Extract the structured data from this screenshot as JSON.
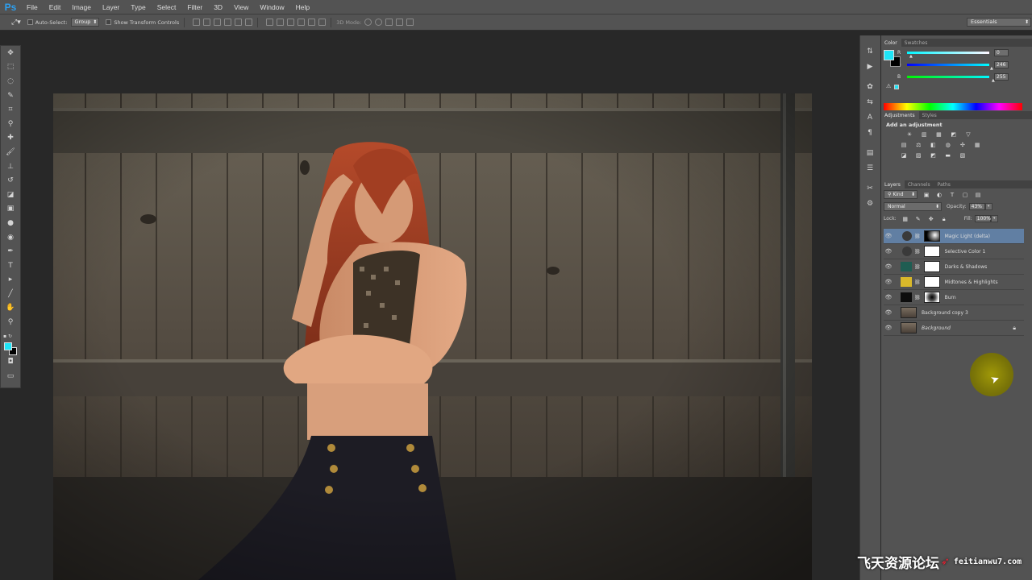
{
  "app": {
    "logo": "Ps"
  },
  "menu": [
    "File",
    "Edit",
    "Image",
    "Layer",
    "Type",
    "Select",
    "Filter",
    "3D",
    "View",
    "Window",
    "Help"
  ],
  "options": {
    "auto_select_label": "Auto-Select:",
    "auto_select_value": "Group",
    "transform_label": "Show Transform Controls",
    "mode3d_label": "3D Mode:",
    "workspace": "Essentials"
  },
  "color_panel": {
    "tabs": [
      "Color",
      "Swatches"
    ],
    "foreground": "#1ee4f6",
    "background": "#000000",
    "channels": [
      {
        "label": "R",
        "value": "0"
      },
      {
        "label": "G",
        "value": "246"
      },
      {
        "label": "B",
        "value": "255"
      }
    ]
  },
  "adjustments_panel": {
    "tabs": [
      "Adjustments",
      "Styles"
    ],
    "heading": "Add an adjustment"
  },
  "layers_panel": {
    "tabs": [
      "Layers",
      "Channels",
      "Paths"
    ],
    "kind_label": "Kind",
    "blend_mode": "Normal",
    "opacity_label": "Opacity:",
    "opacity_value": "43%",
    "lock_label": "Lock:",
    "fill_label": "Fill:",
    "fill_value": "100%",
    "layers": [
      {
        "name": "Magic Light (delta)",
        "selected": true,
        "thumb_color": "#3a3a3a",
        "mask": "gradient"
      },
      {
        "name": "Selective Color 1",
        "selected": false,
        "thumb_color": "#3a3a3a",
        "mask": "white"
      },
      {
        "name": "Darks & Shadows",
        "selected": false,
        "thumb_color": "#1f5d52",
        "mask": "white"
      },
      {
        "name": "Midtones & Highlights",
        "selected": false,
        "thumb_color": "#d9b82a",
        "mask": "white"
      },
      {
        "name": "Burn",
        "selected": false,
        "thumb_color": "#0d0d0d",
        "mask": "radial"
      },
      {
        "name": "Background copy 3",
        "selected": false,
        "thumb_color": "#6a5f52",
        "mask": "none"
      },
      {
        "name": "Background",
        "selected": false,
        "thumb_color": "#6a5f52",
        "mask": "none",
        "italic": true,
        "locked": true
      }
    ]
  },
  "watermark": {
    "main": "飞天资源论坛",
    "site": "feitianwu7.com"
  }
}
